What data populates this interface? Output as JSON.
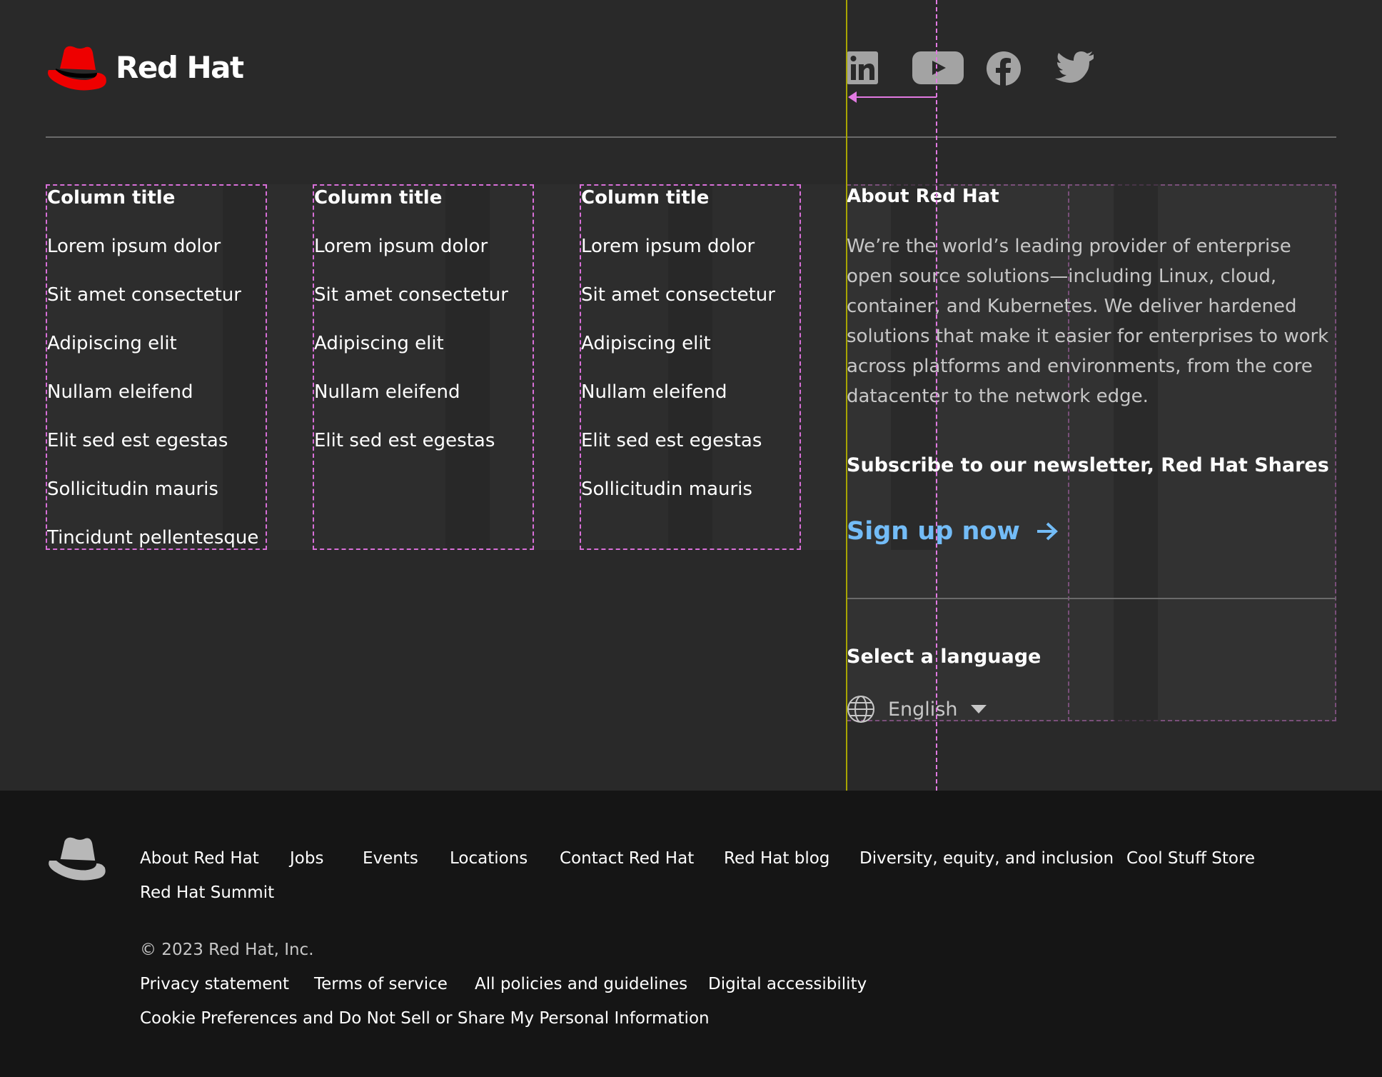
{
  "header": {
    "logo_text": "Red Hat",
    "social": [
      {
        "icon": "linkedin-icon",
        "label": "LinkedIn"
      },
      {
        "icon": "youtube-icon",
        "label": "YouTube"
      },
      {
        "icon": "facebook-icon",
        "label": "Facebook"
      },
      {
        "icon": "twitter-icon",
        "label": "Twitter"
      }
    ]
  },
  "columns": [
    {
      "title": "Column title",
      "links": [
        "Lorem ipsum dolor",
        "Sit amet consectetur",
        "Adipiscing elit",
        "Nullam eleifend",
        "Elit sed est egestas",
        "Sollicitudin mauris",
        "Tincidunt pellentesque"
      ]
    },
    {
      "title": "Column title",
      "links": [
        "Lorem ipsum dolor",
        "Sit amet consectetur",
        "Adipiscing elit",
        "Nullam eleifend",
        "Elit sed est egestas"
      ]
    },
    {
      "title": "Column title",
      "links": [
        "Lorem ipsum dolor",
        "Sit amet consectetur",
        "Adipiscing elit",
        "Nullam eleifend",
        "Elit sed est egestas",
        "Sollicitudin mauris"
      ]
    }
  ],
  "about": {
    "title": "About Red Hat",
    "text": "We’re the world’s leading provider of enterprise open source solutions—including Linux, cloud, container, and Kubernetes. We deliver hardened solutions that make it easier for enterprises to work across platforms and environments, from the core datacenter to the network edge.",
    "subscribe": "Subscribe to our newsletter, Red Hat Shares",
    "signup": "Sign up now",
    "language_title": "Select a language",
    "language": "English"
  },
  "footer": {
    "links": [
      "About Red Hat",
      "Jobs",
      "Events",
      "Locations",
      "Contact Red Hat",
      "Red Hat blog",
      "Diversity, equity, and inclusion",
      "Cool Stuff Store",
      "Red Hat Summit"
    ],
    "copyright": "© 2023 Red Hat, Inc.",
    "policies": [
      "Privacy statement",
      "Terms of service",
      "All policies and guidelines",
      "Digital accessibility",
      "Cookie Preferences and Do Not Sell or Share My Personal Information"
    ]
  },
  "colors": {
    "background": "#292929",
    "bottom": "#151515",
    "accent_link": "#73bcf7",
    "brand_red": "#ee0000"
  }
}
